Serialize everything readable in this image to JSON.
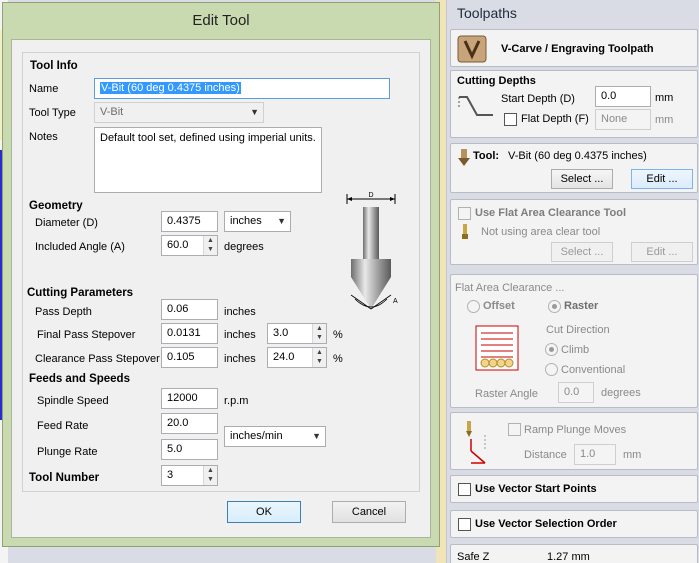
{
  "dialog": {
    "title": "Edit Tool",
    "tool_info": {
      "heading": "Tool Info",
      "name_label": "Name",
      "name_value": "V-Bit (60 deg 0.4375 inches)",
      "type_label": "Tool Type",
      "type_value": "V-Bit",
      "notes_label": "Notes",
      "notes_value": "Default tool set, defined using imperial units."
    },
    "geometry": {
      "heading": "Geometry",
      "diameter_label": "Diameter (D)",
      "diameter_value": "0.4375",
      "diameter_unit": "inches",
      "angle_label": "Included Angle (A)",
      "angle_value": "60.0",
      "angle_unit": "degrees",
      "diagram_d": "D",
      "diagram_a": "A"
    },
    "cutting": {
      "heading": "Cutting Parameters",
      "pass_depth_label": "Pass Depth",
      "pass_depth_value": "0.06",
      "pass_depth_unit": "inches",
      "final_stepover_label": "Final Pass Stepover",
      "final_stepover_value": "0.0131",
      "final_stepover_unit": "inches",
      "final_stepover_pct": "3.0",
      "clear_stepover_label": "Clearance Pass Stepover",
      "clear_stepover_value": "0.105",
      "clear_stepover_unit": "inches",
      "clear_stepover_pct": "24.0",
      "pct_symbol": "%"
    },
    "feeds": {
      "heading": "Feeds and Speeds",
      "spindle_label": "Spindle Speed",
      "spindle_value": "12000",
      "spindle_unit": "r.p.m",
      "feed_label": "Feed Rate",
      "feed_value": "20.0",
      "plunge_label": "Plunge Rate",
      "plunge_value": "5.0",
      "rate_unit": "inches/min"
    },
    "tool_number": {
      "label": "Tool Number",
      "value": "3"
    },
    "ok_label": "OK",
    "cancel_label": "Cancel"
  },
  "panel": {
    "title": "Toolpaths",
    "header_label": "V-Carve / Engraving Toolpath",
    "cutting_depths": {
      "heading": "Cutting Depths",
      "start_label": "Start Depth (D)",
      "start_value": "0.0",
      "start_unit": "mm",
      "flat_label": "Flat Depth (F)",
      "flat_placeholder": "None",
      "flat_unit": "mm"
    },
    "tool": {
      "label": "Tool:",
      "value": "V-Bit (60 deg 0.4375 inches)",
      "select_label": "Select ...",
      "edit_label": "Edit ..."
    },
    "flat_area_tool": {
      "checkbox_label": "Use Flat Area Clearance Tool",
      "status": "Not using area clear tool",
      "select_label": "Select ...",
      "edit_label": "Edit ..."
    },
    "flat_area_clearance": {
      "heading": "Flat Area Clearance ...",
      "offset_label": "Offset",
      "raster_label": "Raster",
      "cut_direction_label": "Cut Direction",
      "climb_label": "Climb",
      "conventional_label": "Conventional",
      "raster_angle_label": "Raster Angle",
      "raster_angle_value": "0.0",
      "raster_angle_unit": "degrees"
    },
    "ramp": {
      "checkbox_label": "Ramp Plunge Moves",
      "distance_label": "Distance",
      "distance_value": "1.0",
      "distance_unit": "mm"
    },
    "vector_start_label": "Use Vector Start Points",
    "vector_order_label": "Use Vector Selection Order",
    "safe_z": {
      "label": "Safe Z",
      "value": "1.27 mm"
    }
  }
}
